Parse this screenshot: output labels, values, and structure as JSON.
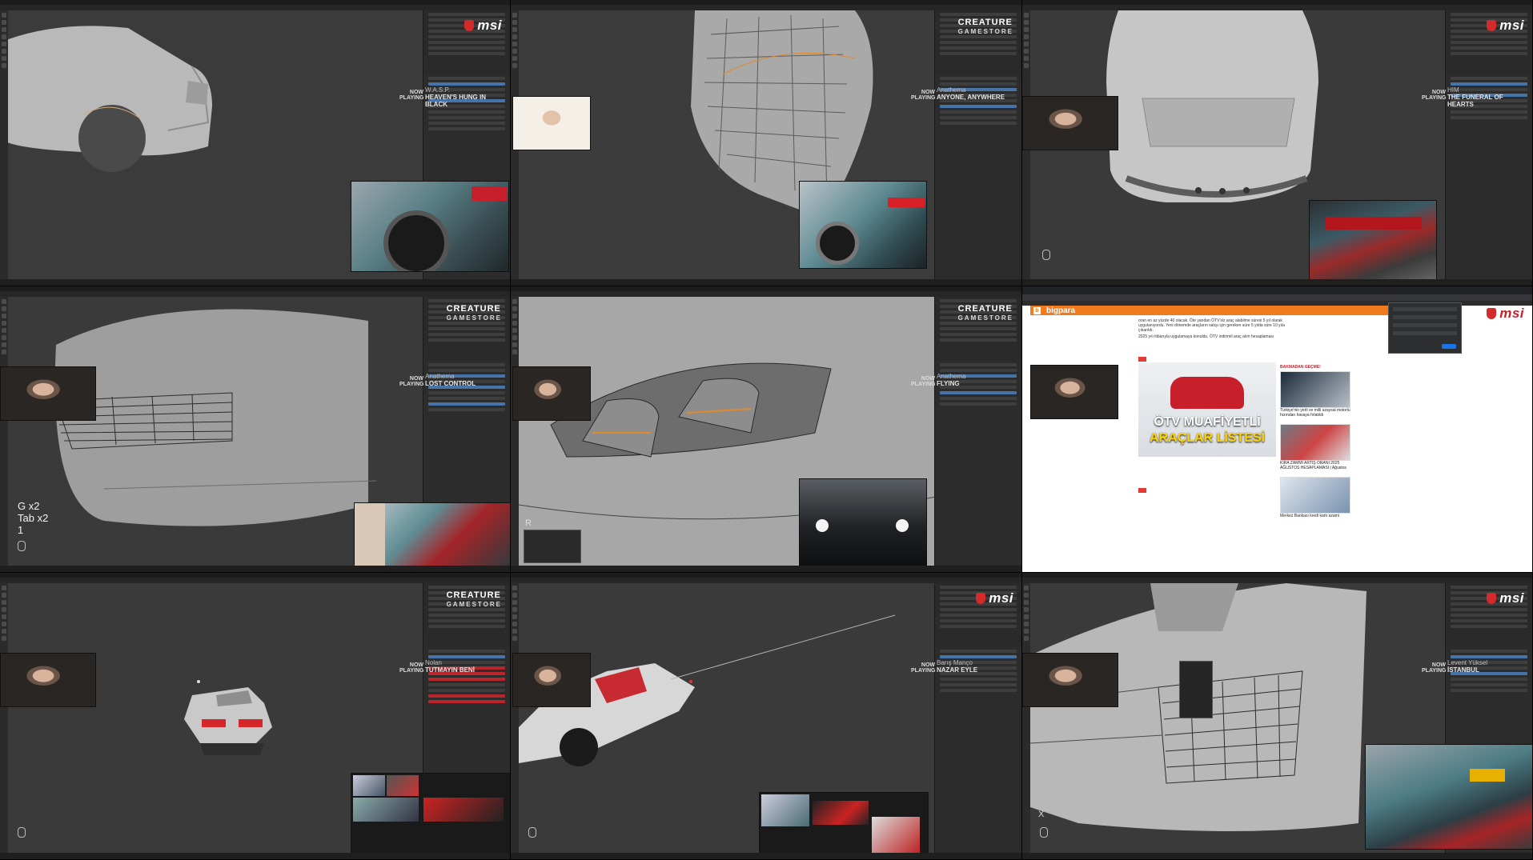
{
  "cells": [
    {
      "id": "cell-1",
      "logo": "msi",
      "now_playing": "NOW PLAYING",
      "artist": "W.A.S.P.",
      "song": "HEAVEN'S HUNG IN BLACK"
    },
    {
      "id": "cell-2",
      "logo": "CREATURE",
      "logo_sub": "GAMESTORE",
      "now_playing": "NOW PLAYING",
      "artist": "Anathema",
      "song": "ANYONE, ANYWHERE"
    },
    {
      "id": "cell-3",
      "logo": "msi",
      "now_playing": "NOW PLAYING",
      "artist": "HIM",
      "song": "THE FUNERAL OF HEARTS"
    },
    {
      "id": "cell-4",
      "logo": "CREATURE",
      "logo_sub": "GAMESTORE",
      "now_playing": "NOW PLAYING",
      "artist": "Anathema",
      "song": "LOST CONTROL",
      "keys": [
        "G x2",
        "Tab x2",
        "1"
      ]
    },
    {
      "id": "cell-5",
      "logo": "CREATURE",
      "logo_sub": "GAMESTORE",
      "now_playing": "NOW PLAYING",
      "artist": "Anathema",
      "song": "FLYING",
      "key_letter": "R"
    },
    {
      "id": "cell-6",
      "logo": "msi",
      "site_name": "bigpara",
      "headline_l1": "ÖTV MUAFİYETLİ",
      "headline_l2": "ARAÇLAR LİSTESİ",
      "side_title": "BAKMADAN GEÇME!",
      "article": [
        "oran en az yüzde 40 olacak. Öte yandan ÖTV'siz araç alabilme süresi 5 yıl olarak uygulanıyordu. Yeni dönemde araçların satışı için gereken süre 5 yılda süre 10 yıla çıkarıldı.",
        "2025 yılı itibarıyla uygulamaya konuldu. ÖTV indirimli araç alım hesaplaması"
      ],
      "side_caption_1": "Türkiye'nin yerli ve milli uzaysal motorlu hızından havaya fırlatıldı",
      "side_caption_2": "KİRA ZAMMI ARTIŞ ORANI 2025 AĞUSTOS HESAPLAMASI | Ağustos",
      "side_caption_3": "Merkez Bankası kredi kartı azami"
    },
    {
      "id": "cell-7",
      "logo": "CREATURE",
      "logo_sub": "GAMESTORE",
      "now_playing": "NOW PLAYING",
      "artist": "Nolan",
      "song": "TUTMAYIN BENİ"
    },
    {
      "id": "cell-8",
      "logo": "msi",
      "now_playing": "NOW PLAYING",
      "artist": "Barış Manço",
      "song": "NAZAR EYLE"
    },
    {
      "id": "cell-9",
      "logo": "msi",
      "now_playing": "NOW PLAYING",
      "artist": "Levent Yüksel",
      "song": "İSTANBUL",
      "key_letter": "X"
    }
  ],
  "colors": {
    "accent_blue": "#4774a8",
    "accent_red": "#b8262c",
    "site_orange": "#f07b1f",
    "viewport_gray": "#3a3a3a"
  },
  "icons": [
    "mouse-icon",
    "msi-logo-icon",
    "creature-logo-icon",
    "webcam-feed"
  ]
}
